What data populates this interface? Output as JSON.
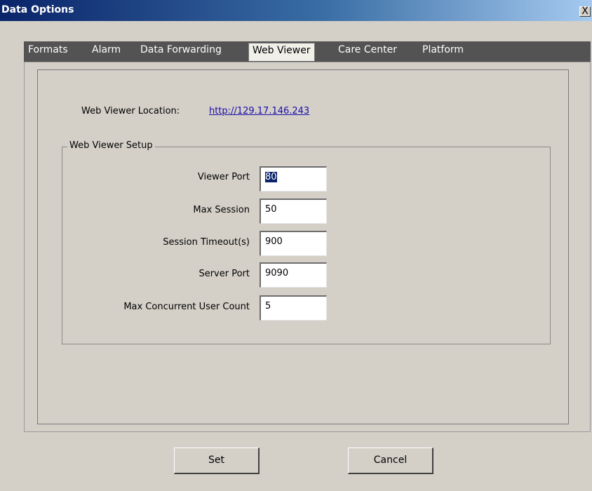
{
  "window": {
    "title": "Data Options",
    "close_label": "X"
  },
  "tabs": [
    {
      "label": "Formats"
    },
    {
      "label": "Alarm"
    },
    {
      "label": "Data Forwarding"
    },
    {
      "label": "Web Viewer",
      "active": true
    },
    {
      "label": "Care Center"
    },
    {
      "label": "Platform"
    }
  ],
  "web_viewer": {
    "location_label": "Web Viewer Location:",
    "location_url": "http://129.17.146.243",
    "setup_group": {
      "title": "Web Viewer Setup",
      "fields": [
        {
          "label": "Viewer Port",
          "value": "80"
        },
        {
          "label": "Max Session",
          "value": "50"
        },
        {
          "label": "Session Timeout(s)",
          "value": "900"
        },
        {
          "label": "Server Port",
          "value": "9090"
        },
        {
          "label": "Max Concurrent User Count",
          "value": "5"
        }
      ]
    }
  },
  "buttons": {
    "set_label": "Set",
    "cancel_label": "Cancel"
  },
  "colors": {
    "titlebar_start": "#0a246a",
    "titlebar_end": "#a6caf0",
    "tabstrip": "#535353",
    "dialog_bg": "#d4d0c8",
    "link": "#1a0dab"
  }
}
